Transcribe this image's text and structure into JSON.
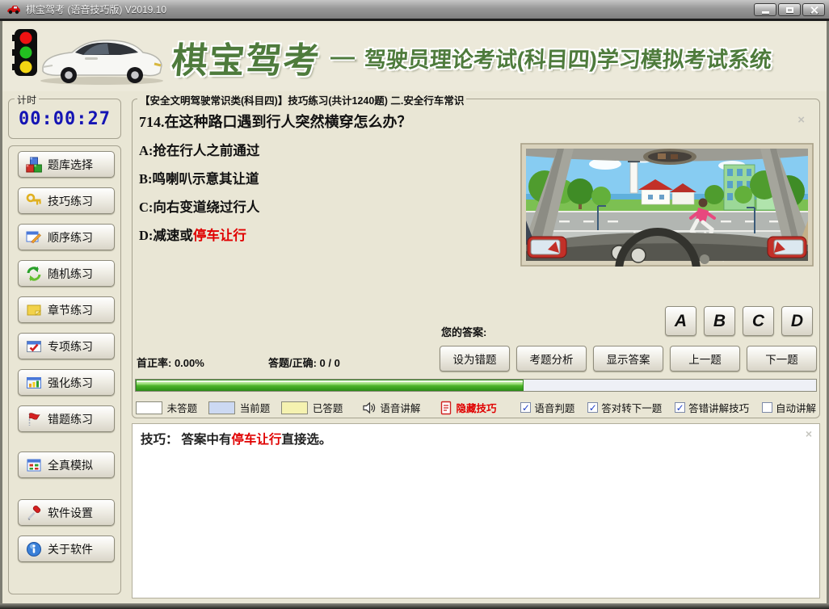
{
  "window": {
    "title": "棋宝驾考 (语音技巧版) V2019.10",
    "close_glyph": "×"
  },
  "header": {
    "brand": "棋宝驾考",
    "dash": "—",
    "subtitle": "驾驶员理论考试(科目四)学习模拟考试系统"
  },
  "sidebar": {
    "timer_label": "计时",
    "timer_value": "00:00:27",
    "buttons": [
      {
        "label": "题库选择",
        "icon": "cubes-icon"
      },
      {
        "label": "技巧练习",
        "icon": "key-icon"
      },
      {
        "label": "顺序练习",
        "icon": "pencil-window-icon"
      },
      {
        "label": "随机练习",
        "icon": "shuffle-arrows-icon"
      },
      {
        "label": "章节练习",
        "icon": "sticky-note-icon"
      },
      {
        "label": "专项练习",
        "icon": "checked-window-icon"
      },
      {
        "label": "强化练习",
        "icon": "bar-chart-icon"
      },
      {
        "label": "错题练习",
        "icon": "red-flag-icon"
      },
      {
        "label": "全真模拟",
        "icon": "grid-window-icon"
      },
      {
        "label": "软件设置",
        "icon": "screwdriver-icon"
      },
      {
        "label": "关于软件",
        "icon": "info-icon"
      }
    ]
  },
  "question": {
    "category": "【安全文明驾驶常识类(科目四)】技巧练习(共计1240题)  二.安全行车常识",
    "title": "714.在这种路口遇到行人突然横穿怎么办？",
    "options": [
      {
        "text": "A:抢在行人之前通过",
        "highlight": ""
      },
      {
        "text": "B:鸣喇叭示意其让道",
        "highlight": ""
      },
      {
        "text": "C:向右变道绕过行人",
        "highlight": ""
      },
      {
        "text": "D:减速或",
        "highlight": "停车让行"
      }
    ],
    "your_answer_label": "您的答案:",
    "answer_buttons": [
      "A",
      "B",
      "C",
      "D"
    ],
    "action_buttons": [
      "设为错题",
      "考题分析",
      "显示答案",
      "上一题",
      "下一题"
    ],
    "stats": {
      "first_correct": "首正率: 0.00%",
      "answered": "答题/正确: 0 / 0"
    },
    "progress_percent": 57
  },
  "legend": {
    "swatches": [
      {
        "label": "未答题",
        "color": "#ffffff"
      },
      {
        "label": "当前题",
        "color": "#ccd9f2"
      },
      {
        "label": "已答题",
        "color": "#f5f2b0"
      }
    ],
    "voice_explain": "语音讲解",
    "hide_tip": "隐藏技巧",
    "checkboxes": [
      {
        "label": "语音判题",
        "mark": "✓"
      },
      {
        "label": "答对转下一题",
        "mark": "✓"
      },
      {
        "label": "答错讲解技巧",
        "mark": "✓"
      },
      {
        "label": "自动讲解",
        "mark": ""
      }
    ]
  },
  "tip": {
    "prefix": "技巧： 答案中有",
    "highlight": "停车让行",
    "suffix": "直接选。"
  },
  "colors": {
    "accent_green": "#4e7b3c",
    "timer_blue": "#1414b4",
    "alert_red": "#e00000",
    "progress_green": "#4db32a"
  }
}
